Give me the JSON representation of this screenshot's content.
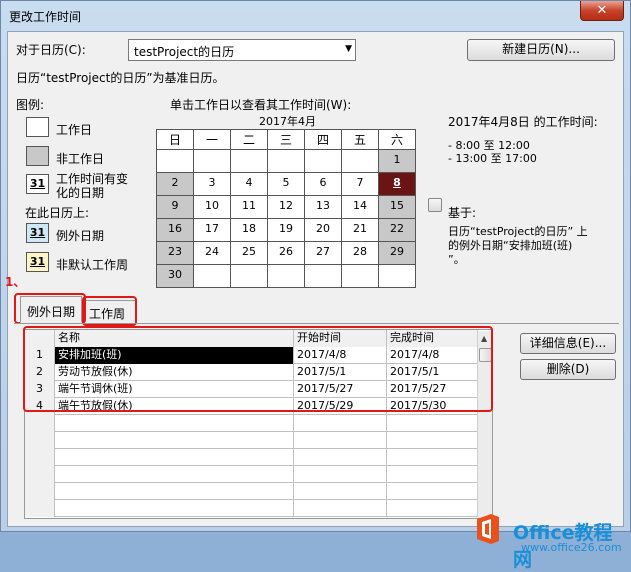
{
  "window": {
    "title": "更改工作时间",
    "close_glyph": "✕"
  },
  "calendar_select": {
    "label": "对于日历(C):",
    "value": "testProject的日历"
  },
  "new_calendar_button": "新建日历(N)...",
  "base_info": "日历“testProject的日历”为基准日历。",
  "legend": {
    "title": "图例:",
    "items": [
      {
        "label": "工作日",
        "symbol": ""
      },
      {
        "label": "非工作日",
        "symbol": ""
      },
      {
        "label": "工作时间有变化的日期",
        "symbol": "31"
      }
    ],
    "on_calendar_title": "在此日历上:",
    "calendar_items": [
      {
        "label": "例外日期",
        "symbol": "31"
      },
      {
        "label": "非默认工作周",
        "symbol": "31"
      }
    ]
  },
  "calendar": {
    "instruction": "单击工作日以查看其工作时间(W):",
    "month_title": "2017年4月",
    "weekdays": [
      "日",
      "一",
      "二",
      "三",
      "四",
      "五",
      "六"
    ],
    "weeks": [
      [
        "",
        "",
        "",
        "",
        "",
        "",
        "1"
      ],
      [
        "2",
        "3",
        "4",
        "5",
        "6",
        "7",
        "8"
      ],
      [
        "9",
        "10",
        "11",
        "12",
        "13",
        "14",
        "15"
      ],
      [
        "16",
        "17",
        "18",
        "19",
        "20",
        "21",
        "22"
      ],
      [
        "23",
        "24",
        "25",
        "26",
        "27",
        "28",
        "29"
      ],
      [
        "30",
        "",
        "",
        "",
        "",
        "",
        ""
      ]
    ]
  },
  "work_time_panel": {
    "heading": "2017年4月8日 的工作时间:",
    "times": [
      "- 8:00 至 12:00",
      "- 13:00 至 17:00"
    ],
    "based_on_label": "基于:",
    "based_on_text_1": "日历“testProject的日历” 上",
    "based_on_text_2": "的例外日期“安排加班(班)",
    "based_on_text_3": "”。"
  },
  "annotation_number": "1、",
  "tabs": [
    {
      "label": "例外日期"
    },
    {
      "label": "工作周"
    }
  ],
  "exceptions_table": {
    "columns": [
      "名称",
      "开始时间",
      "完成时间"
    ],
    "rows": [
      {
        "num": "1",
        "name": "安排加班(班)",
        "start": "2017/4/8",
        "finish": "2017/4/8"
      },
      {
        "num": "2",
        "name": "劳动节放假(休)",
        "start": "2017/5/1",
        "finish": "2017/5/1"
      },
      {
        "num": "3",
        "name": "端午节调休(班)",
        "start": "2017/5/27",
        "finish": "2017/5/27"
      },
      {
        "num": "4",
        "name": "端午节放假(休)",
        "start": "2017/5/29",
        "finish": "2017/5/30"
      }
    ]
  },
  "details_button": "详细信息(E)...",
  "delete_button": "删除(D)",
  "watermark": {
    "brand": "Office教程网",
    "url": "www.office26.com"
  }
}
